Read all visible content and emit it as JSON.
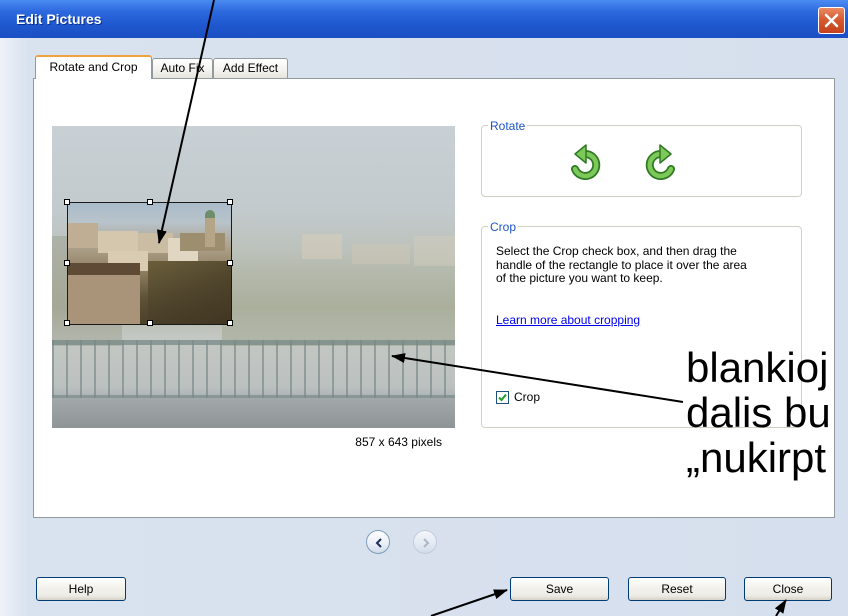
{
  "window": {
    "title": "Edit Pictures"
  },
  "tabs": [
    {
      "label": "Rotate and Crop",
      "active": true
    },
    {
      "label": "Auto Fix",
      "active": false
    },
    {
      "label": "Add Effect",
      "active": false
    }
  ],
  "picture": {
    "size_label": "857 x 643 pixels"
  },
  "rotate": {
    "legend": "Rotate"
  },
  "crop": {
    "legend": "Crop",
    "description_lines": [
      "Select the Crop check box, and then drag the",
      "handle of the rectangle to place it over the area",
      "of the picture you want to keep."
    ],
    "link": "Learn more about cropping",
    "checkbox_label": "Crop",
    "checked": true
  },
  "nav": {
    "previous_enabled": true,
    "next_enabled": false
  },
  "buttons": {
    "help": "Help",
    "save": "Save",
    "reset": "Reset",
    "close": "Close"
  },
  "annotation": {
    "lines": [
      "blankioj",
      "dalis bu",
      "„nukirpt"
    ]
  },
  "icons": {
    "window_close": "close-icon",
    "rotate_left": "rotate-left-icon",
    "rotate_right": "rotate-right-icon",
    "previous": "chevron-left-icon",
    "next": "chevron-right-icon",
    "checkbox": "checkmark-icon"
  },
  "colors": {
    "title_bar": "#2a62d9",
    "tab_highlight": "#f0a23c",
    "link": "#0000ee",
    "legend": "#1d55c0",
    "rotate_icon": "#5cb548",
    "annotation_text": "#000000"
  }
}
